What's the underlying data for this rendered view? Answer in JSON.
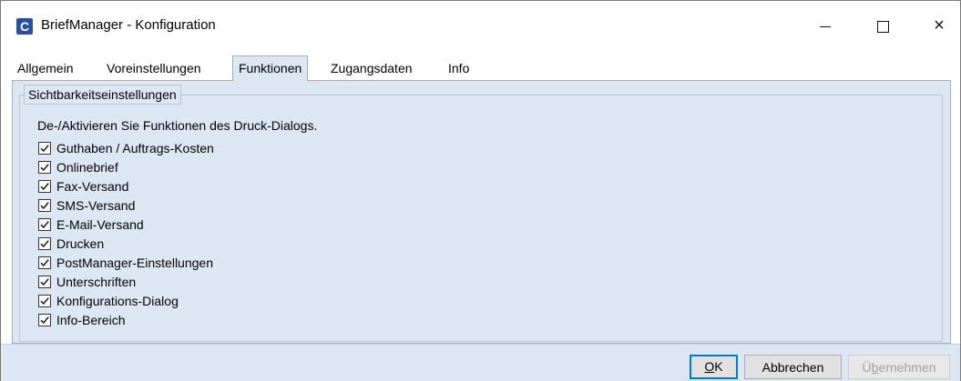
{
  "window": {
    "title": "BriefManager - Konfiguration",
    "icon_letter": "C",
    "controls": {
      "minimize": "minimize-icon",
      "maximize": "maximize-icon",
      "close": "×"
    }
  },
  "tabs": [
    {
      "label": "Allgemein",
      "active": false
    },
    {
      "label": "Voreinstellungen",
      "active": false
    },
    {
      "label": "Funktionen",
      "active": true
    },
    {
      "label": "Zugangsdaten",
      "active": false
    },
    {
      "label": "Info",
      "active": false
    }
  ],
  "group": {
    "title": "Sichtbarkeitseinstellungen",
    "description": "De-/Aktivieren Sie Funktionen des Druck-Dialogs.",
    "checkboxes": [
      {
        "label": "Guthaben / Auftrags-Kosten",
        "checked": true
      },
      {
        "label": "Onlinebrief",
        "checked": true
      },
      {
        "label": "Fax-Versand",
        "checked": true
      },
      {
        "label": "SMS-Versand",
        "checked": true
      },
      {
        "label": "E-Mail-Versand",
        "checked": true
      },
      {
        "label": "Drucken",
        "checked": true
      },
      {
        "label": "PostManager-Einstellungen",
        "checked": true
      },
      {
        "label": "Unterschriften",
        "checked": true
      },
      {
        "label": "Konfigurations-Dialog",
        "checked": true
      },
      {
        "label": "Info-Bereich",
        "checked": true
      }
    ]
  },
  "buttons": {
    "ok": {
      "mnemonic": "O",
      "rest": "K"
    },
    "cancel": {
      "label": "Abbrechen"
    },
    "apply": {
      "prefix": "Ü",
      "mnemonic": "b",
      "rest": "ernehmen",
      "enabled": false
    }
  },
  "colors": {
    "panel_background": "#dde7f3",
    "accent_focus": "#0078d7",
    "app_icon": "#2b4f9e"
  }
}
